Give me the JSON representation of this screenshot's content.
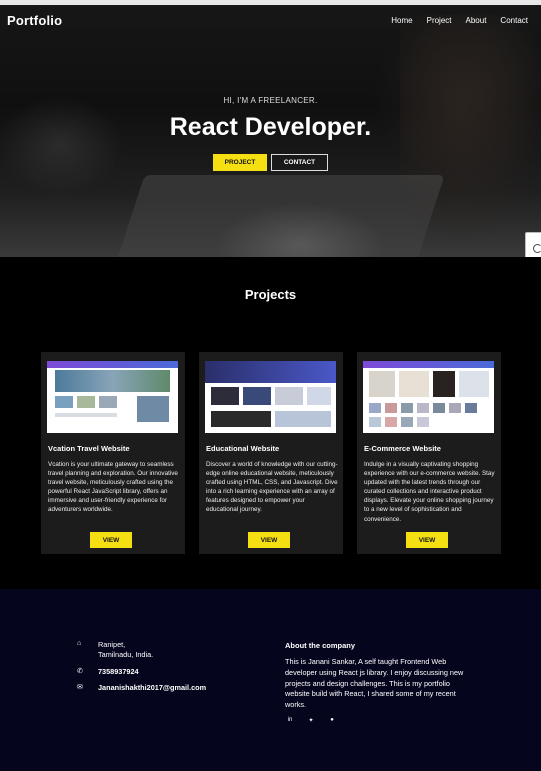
{
  "nav": {
    "brand": "Portfolio",
    "items": [
      "Home",
      "Project",
      "About",
      "Contact"
    ]
  },
  "hero": {
    "subtitle": "HI, I'M A FREELANCER.",
    "title": "React Developer.",
    "project_button": "PROJECT",
    "contact_button": "CONTACT"
  },
  "projects": {
    "title": "Projects",
    "cards": [
      {
        "title": "Vcation Travel Website",
        "description": "Vcation is your ultimate gateway to seamless travel planning and exploration. Our innovative travel website, meticulously crafted using the powerful React JavaScript library, offers an immersive and user-friendly experience for adventurers worldwide.",
        "button": "VIEW"
      },
      {
        "title": "Educational Website",
        "description": "Discover a world of knowledge with our cutting-edge online educational website, meticulously crafted using HTML, CSS, and Javascript. Dive into a rich learning experience with an array of features designed to empower your educational journey.",
        "button": "VIEW"
      },
      {
        "title": "E-Commerce Website",
        "description": "Indulge in a visually captivating shopping experience with our e-commerce website. Stay updated with the latest trends through our curated collections and interactive product displays. Elevate your online shopping journey to a new level of sophistication and convenience.",
        "button": "VIEW"
      }
    ]
  },
  "footer": {
    "address_line1": "Ranipet,",
    "address_line2": "Tamilnadu, India.",
    "phone": "7358937924",
    "email": "Jananishakthi2017@gmail.com",
    "about_heading": "About the company",
    "about_text": "This is Janani Sankar, A self taught Frontend Web developer using React js library. I enjoy discussing new projects and design challenges. This is my portfolio website build with React, I shared some of my recent works.",
    "icons": [
      "home-icon",
      "phone-icon",
      "mail-icon"
    ],
    "social_icons": [
      "linkedin-icon",
      "twitter-icon",
      "github-icon"
    ]
  },
  "colors": {
    "accent": "#f5df12",
    "footer_bg": "#05051e",
    "card_bg": "#1c1c1c"
  }
}
